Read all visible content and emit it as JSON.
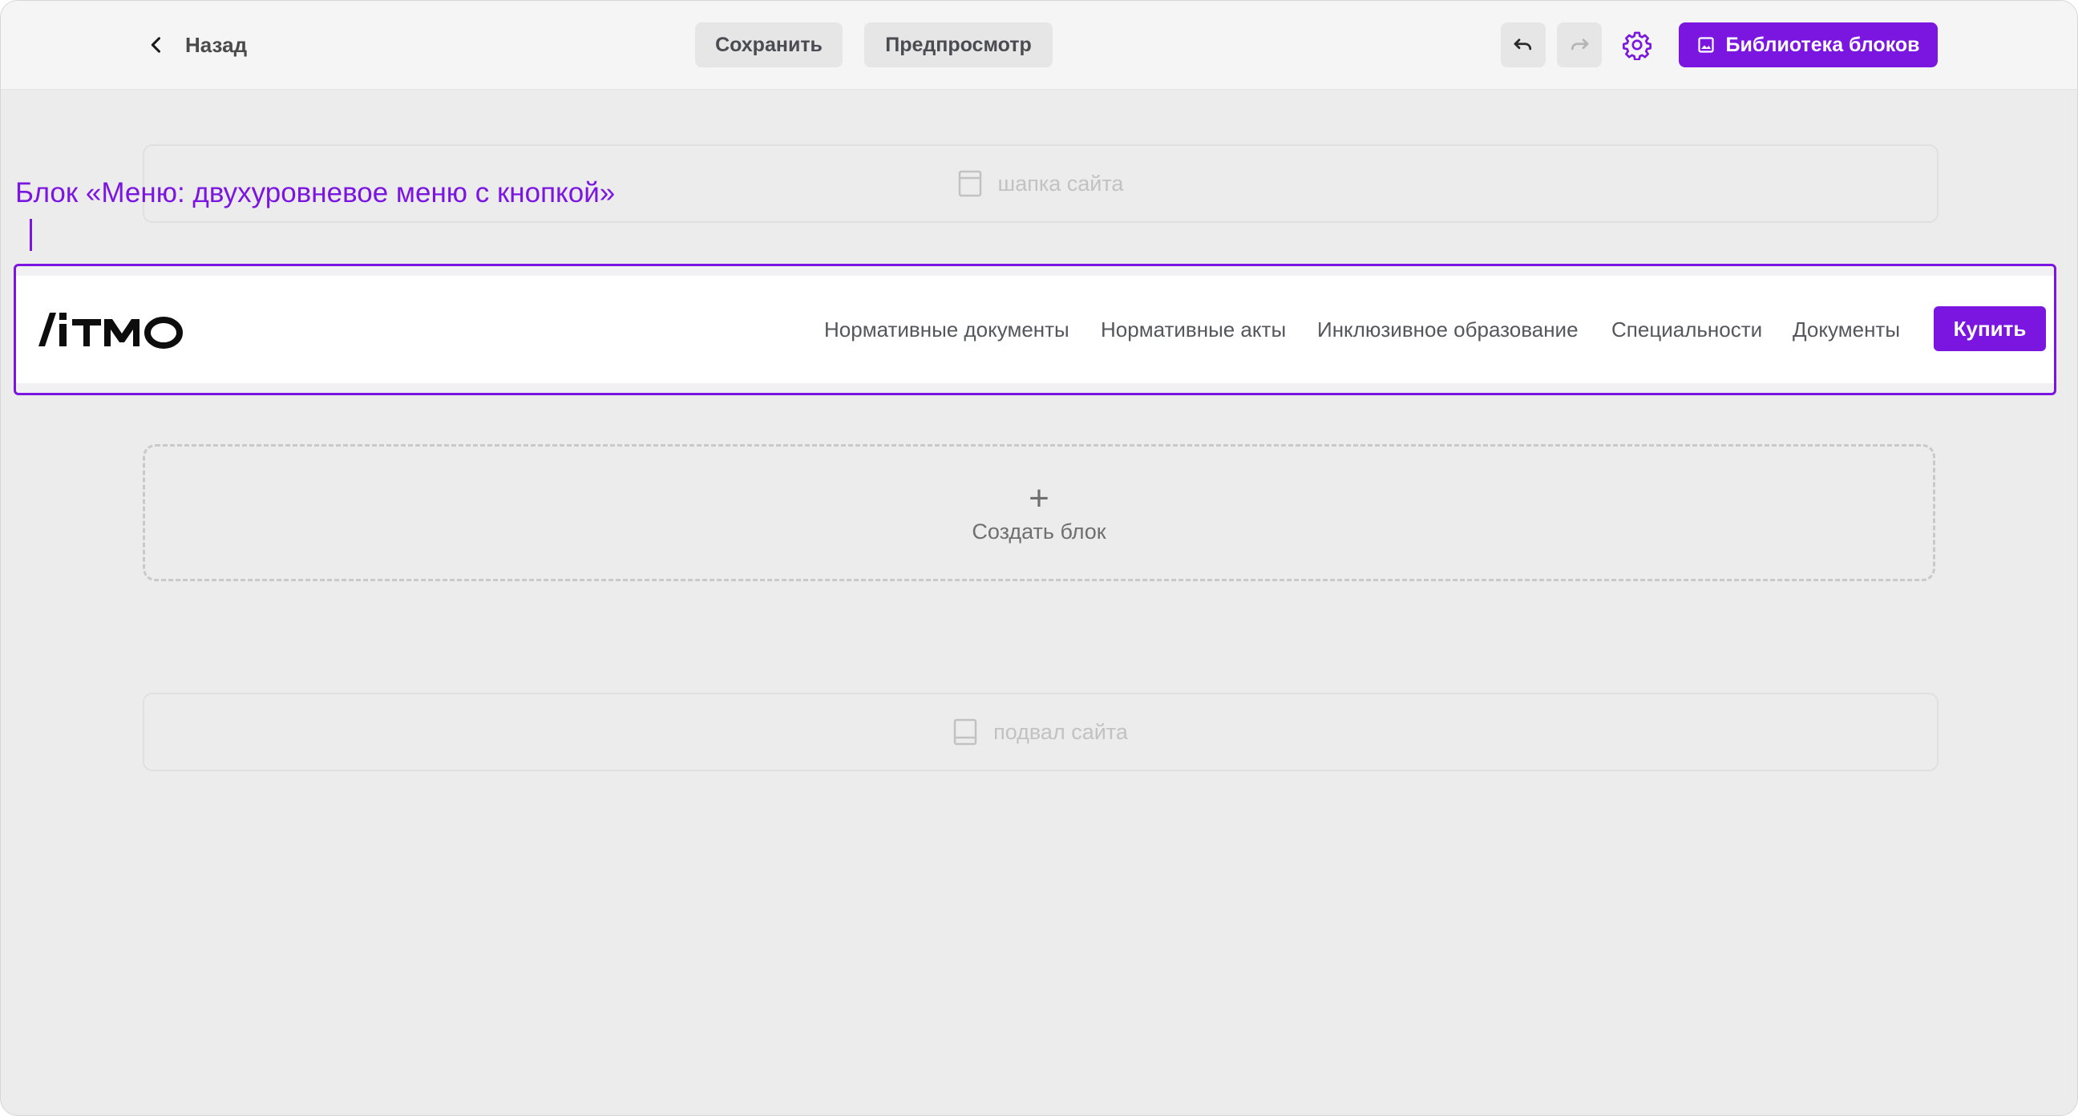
{
  "toolbar": {
    "back_label": "Назад",
    "save_label": "Сохранить",
    "preview_label": "Предпросмотр",
    "library_label": "Библиотека блоков",
    "icons": {
      "back": "chevron-left-icon",
      "undo": "undo-icon",
      "redo": "redo-icon",
      "settings": "gear-icon",
      "library": "image-icon"
    }
  },
  "canvas": {
    "header_placeholder": "шапка сайта",
    "footer_placeholder": "подвал сайта",
    "annotation": "Блок «Меню: двухуровневое меню с кнопкой»",
    "create_block_label": "Создать блок",
    "create_block_icon": "+",
    "menu_block": {
      "logo_text": "ITMO",
      "nav_items": [
        "Нормативные документы",
        "Нормативные акты",
        "Инклюзивное образование",
        "Специальности",
        "Документы"
      ],
      "button_label": "Купить"
    }
  },
  "colors": {
    "accent": "#7a16e0",
    "canvas_bg": "#ececec",
    "toolbar_bg": "#f5f5f5"
  }
}
